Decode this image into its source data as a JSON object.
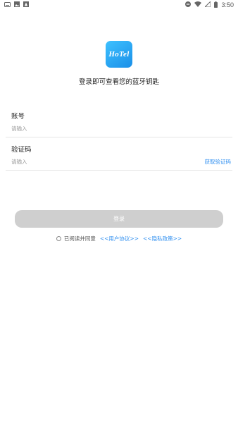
{
  "status_bar": {
    "time": "3:50",
    "left_icons": [
      "keyboard-icon",
      "image-icon",
      "accessibility-icon"
    ],
    "right_icons": [
      "do-not-disturb-icon",
      "wifi-icon",
      "signal-icon",
      "battery-icon"
    ]
  },
  "app": {
    "logo_text": "HoTel",
    "tagline": "登录即可查看您的蓝牙钥匙"
  },
  "form": {
    "account_label": "账号",
    "account_placeholder": "请输入",
    "code_label": "验证码",
    "code_placeholder": "请输入",
    "get_code_label": "获取验证码"
  },
  "login_button_label": "登录",
  "agreement": {
    "prefix": "已阅读并同意",
    "user_agreement": "<<用户协议>>",
    "privacy_policy": "<<隐私政策>>"
  },
  "colors": {
    "accent": "#2f8ff0",
    "button_disabled": "#cfcfcf",
    "logo_gradient_start": "#3ec1ff",
    "logo_gradient_end": "#1a8fe8"
  }
}
